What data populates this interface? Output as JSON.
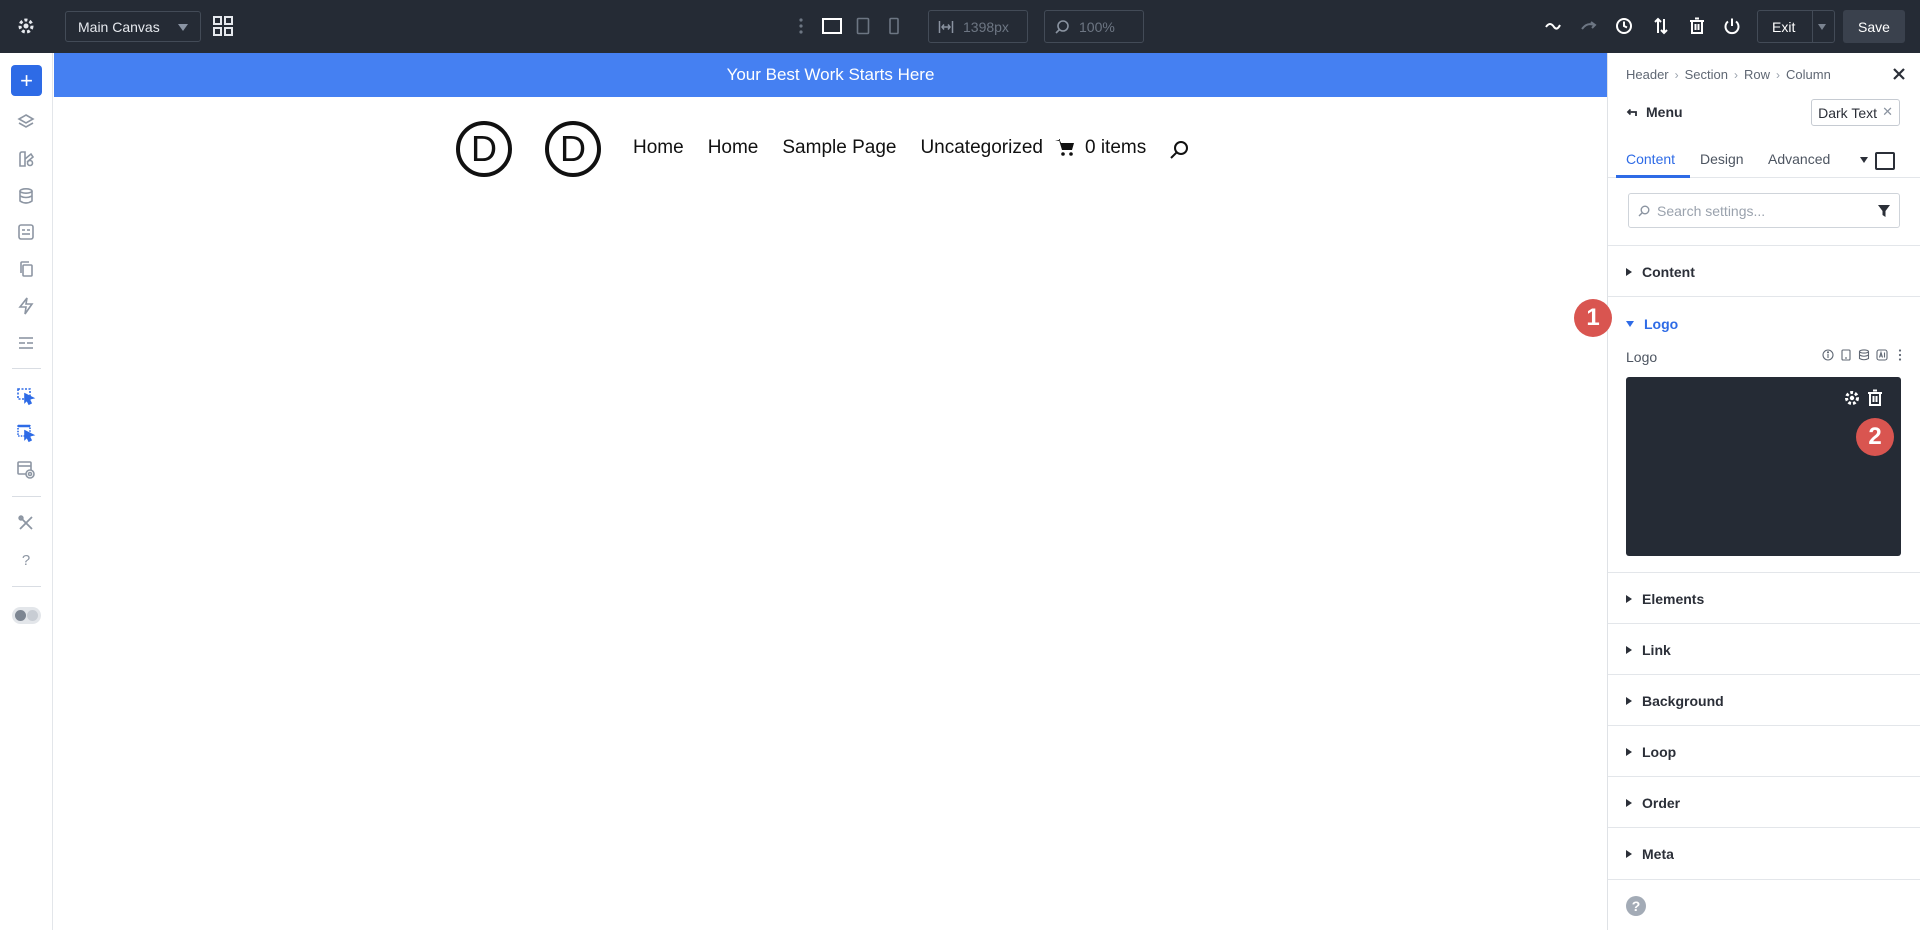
{
  "topbar": {
    "canvas_select": "Main Canvas",
    "width_value": "1398px",
    "zoom_value": "100%",
    "exit_label": "Exit",
    "save_label": "Save"
  },
  "canvas": {
    "announcement": "Your Best Work Starts Here",
    "logo_letter": "D",
    "nav": [
      "Home",
      "Home",
      "Sample Page",
      "Uncategorized"
    ],
    "cart_label": "0 items"
  },
  "panel": {
    "breadcrumbs": [
      "Header",
      "Section",
      "Row",
      "Column"
    ],
    "module_title": "Menu",
    "preset": "Dark Text",
    "tabs": [
      "Content",
      "Design",
      "Advanced"
    ],
    "search_placeholder": "Search settings...",
    "groups": {
      "content": "Content",
      "logo": "Logo",
      "elements": "Elements",
      "link": "Link",
      "background": "Background",
      "loop": "Loop",
      "order": "Order",
      "meta": "Meta"
    },
    "logo_field_label": "Logo",
    "help": "?"
  },
  "badges": [
    "1",
    "2"
  ],
  "colors": {
    "topbar": "#252b35",
    "accent": "#2e6be6",
    "announcement_bg": "#4580f2",
    "badge": "#d95550"
  }
}
